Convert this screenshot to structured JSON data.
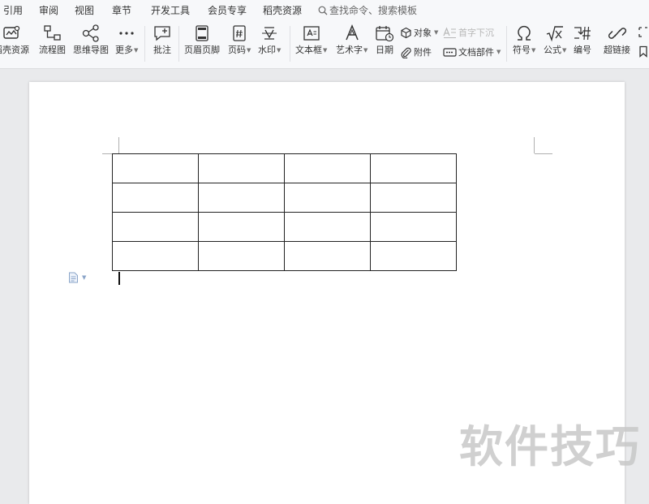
{
  "menu": {
    "items": [
      "引用",
      "审阅",
      "视图",
      "章节",
      "开发工具",
      "会员专享",
      "稻壳资源"
    ],
    "search_placeholder": "查找命令、搜索模板"
  },
  "ribbon": {
    "docer_resources": "稻壳资源",
    "flowchart": "流程图",
    "mindmap": "思维导图",
    "more": "更多",
    "comment": "批注",
    "header_footer": "页眉页脚",
    "page_number": "页码",
    "watermark": "水印",
    "textbox": "文本框",
    "wordart": "艺术字",
    "date": "日期",
    "object": "对象",
    "attachment": "附件",
    "drop_cap": "首字下沉",
    "doc_parts": "文档部件",
    "symbol": "符号",
    "formula": "公式",
    "numbering": "编号",
    "hyperlink": "超链接"
  },
  "document": {
    "table": {
      "rows": 4,
      "cols": 4
    }
  },
  "watermark_text": "软件技巧"
}
